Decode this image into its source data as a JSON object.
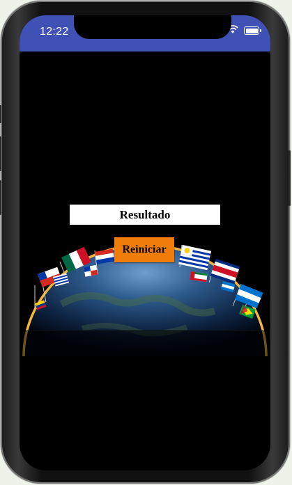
{
  "status_bar": {
    "time": "12:22",
    "icons": [
      "wifi-icon",
      "battery-icon"
    ],
    "color": "#3f51b5"
  },
  "result": {
    "label": "Resultado"
  },
  "actions": {
    "reset_label": "Reiniciar",
    "reset_color": "#f07c0a"
  },
  "artwork": {
    "name": "earth-with-flags-illustration"
  }
}
